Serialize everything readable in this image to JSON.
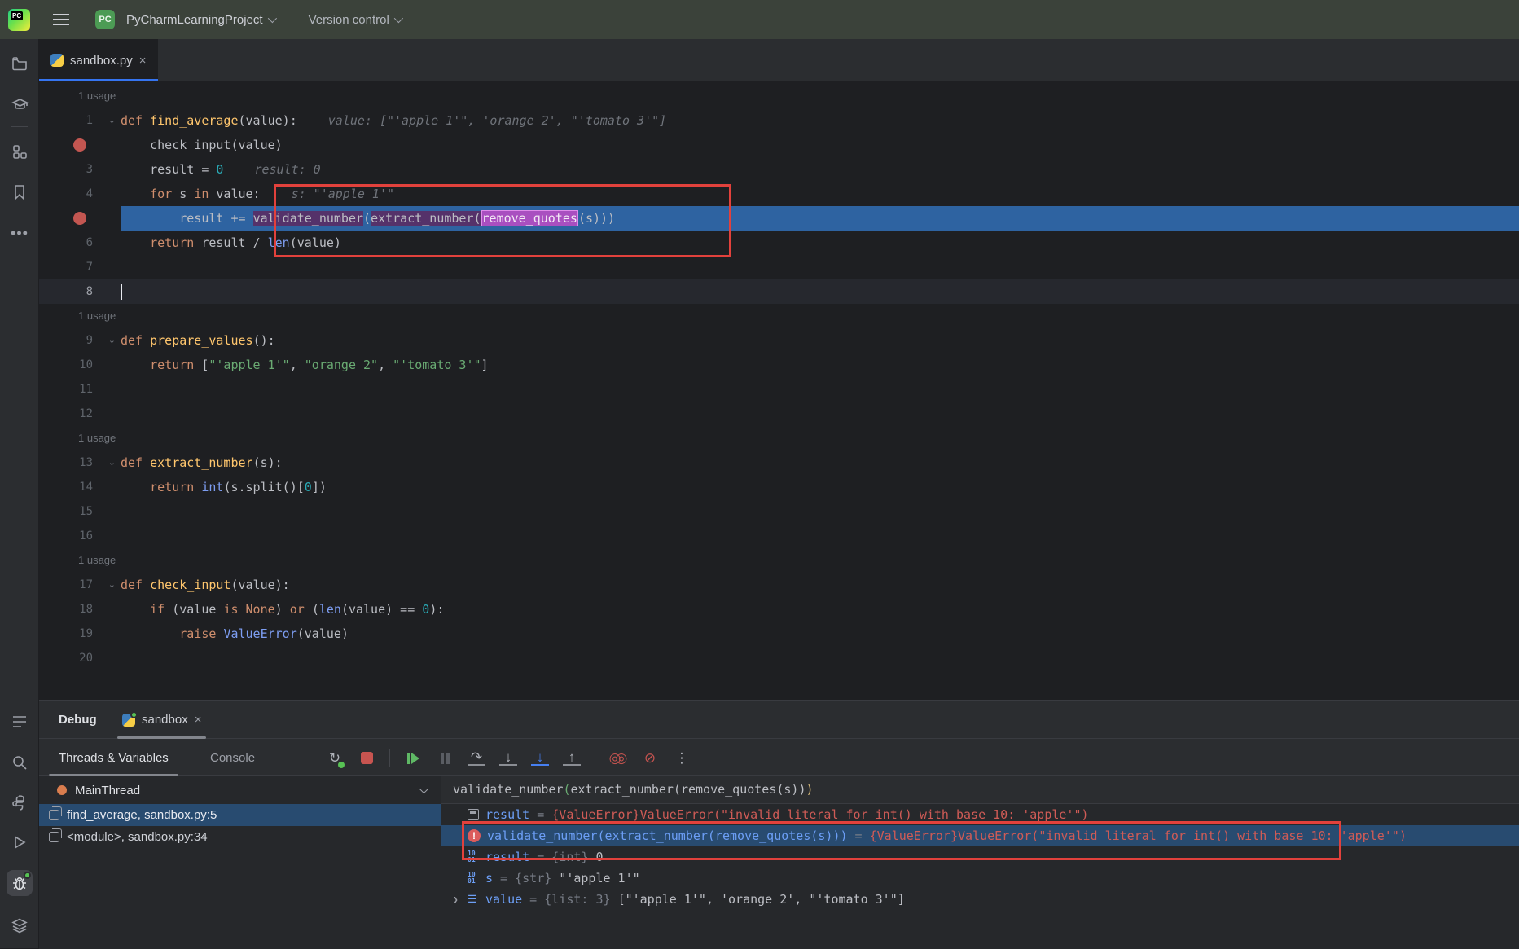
{
  "header": {
    "project_name": "PyCharmLearningProject",
    "vcs_label": "Version control",
    "logo_text": "PC",
    "project_badge": "PC"
  },
  "editor_tab": {
    "label": "sandbox.py",
    "close": "×"
  },
  "editor": {
    "rows": [
      {
        "usage": "1 usage"
      },
      {
        "n": "1",
        "fold": true,
        "segs": [
          [
            "kw",
            "def "
          ],
          [
            "fn",
            "find_average"
          ],
          [
            "plain",
            "(value):"
          ]
        ],
        "hint": "value: [\"'apple 1'\", 'orange 2', \"'tomato 3'\"]"
      },
      {
        "bp": true,
        "segs": [
          [
            "plain",
            "    check_input(value)"
          ]
        ]
      },
      {
        "n": "3",
        "segs": [
          [
            "plain",
            "    result = "
          ],
          [
            "num",
            "0"
          ]
        ],
        "hint": "result: 0"
      },
      {
        "n": "4",
        "segs": [
          [
            "kw",
            "    for "
          ],
          [
            "plain",
            "s "
          ],
          [
            "kw",
            "in "
          ],
          [
            "plain",
            "value:"
          ]
        ],
        "hint": "s: \"'apple 1'\""
      },
      {
        "bp": true,
        "cur": true,
        "segs": [
          [
            "plain",
            "        result += "
          ],
          [
            "p1",
            "validate_number"
          ],
          [
            "plain",
            "("
          ],
          [
            "p1",
            "extract_number("
          ],
          [
            "p2",
            "remove_quotes"
          ],
          [
            "plain",
            "(s)))"
          ]
        ]
      },
      {
        "n": "6",
        "segs": [
          [
            "kw",
            "    return "
          ],
          [
            "plain",
            "result / "
          ],
          [
            "builtin",
            "len"
          ],
          [
            "plain",
            "(value)"
          ]
        ]
      },
      {
        "n": "7",
        "segs": []
      },
      {
        "n": "8",
        "caret": true,
        "segs": []
      },
      {
        "usage": "1 usage"
      },
      {
        "n": "9",
        "fold": true,
        "segs": [
          [
            "kw",
            "def "
          ],
          [
            "fn",
            "prepare_values"
          ],
          [
            "plain",
            "():"
          ]
        ]
      },
      {
        "n": "10",
        "segs": [
          [
            "kw",
            "    return "
          ],
          [
            "plain",
            "["
          ],
          [
            "str",
            "\"'apple 1'\""
          ],
          [
            "plain",
            ", "
          ],
          [
            "str",
            "\"orange 2\""
          ],
          [
            "plain",
            ", "
          ],
          [
            "str",
            "\"'tomato 3'\""
          ],
          [
            "plain",
            "]"
          ]
        ]
      },
      {
        "n": "11",
        "segs": []
      },
      {
        "n": "12",
        "segs": []
      },
      {
        "usage": "1 usage"
      },
      {
        "n": "13",
        "fold": true,
        "segs": [
          [
            "kw",
            "def "
          ],
          [
            "fn",
            "extract_number"
          ],
          [
            "plain",
            "(s):"
          ]
        ]
      },
      {
        "n": "14",
        "segs": [
          [
            "kw",
            "    return "
          ],
          [
            "builtin",
            "int"
          ],
          [
            "plain",
            "(s.split()["
          ],
          [
            "num",
            "0"
          ],
          [
            "plain",
            "])"
          ]
        ]
      },
      {
        "n": "15",
        "segs": []
      },
      {
        "n": "16",
        "segs": []
      },
      {
        "usage": "1 usage"
      },
      {
        "n": "17",
        "fold": true,
        "segs": [
          [
            "kw",
            "def "
          ],
          [
            "fn",
            "check_input"
          ],
          [
            "plain",
            "(value):"
          ]
        ]
      },
      {
        "n": "18",
        "segs": [
          [
            "kw",
            "    if "
          ],
          [
            "plain",
            "(value "
          ],
          [
            "kw",
            "is "
          ],
          [
            "kw",
            "None"
          ],
          [
            "plain",
            ") "
          ],
          [
            "kw",
            "or "
          ],
          [
            "plain",
            "("
          ],
          [
            "builtin",
            "len"
          ],
          [
            "plain",
            "(value) == "
          ],
          [
            "num",
            "0"
          ],
          [
            "plain",
            "):"
          ]
        ]
      },
      {
        "n": "19",
        "segs": [
          [
            "kw",
            "        raise "
          ],
          [
            "builtin",
            "ValueError"
          ],
          [
            "plain",
            "(value)"
          ]
        ]
      },
      {
        "n": "20",
        "segs": []
      }
    ]
  },
  "debug_panel": {
    "title": "Debug",
    "session_tab": {
      "label": "sandbox",
      "close": "×"
    },
    "subtabs": {
      "threads": "Threads & Variables",
      "console": "Console"
    },
    "toolbar_icons": [
      "rerun-debugger",
      "stop",
      "resume",
      "pause",
      "step-over",
      "step-into",
      "force-step-into",
      "step-out",
      "view-breakpoints",
      "mute-breakpoints",
      "more-options"
    ],
    "thread": {
      "name": "MainThread"
    },
    "frames": [
      {
        "label": "find_average, sandbox.py:5",
        "selected": true
      },
      {
        "label": "<module>, sandbox.py:34",
        "selected": false
      }
    ],
    "variables": {
      "header_expression": {
        "pre": "validate_number",
        "open": "(",
        "mid": "extract_number(remove_quotes(s))",
        "close": ")"
      },
      "rows": [
        {
          "icon": "eval",
          "struck": true,
          "segs": [
            [
              "name",
              "result"
            ],
            [
              "eq",
              " = "
            ],
            [
              "err",
              "{ValueError}ValueError(\"invalid literal for int() with base 10: 'apple'\")"
            ]
          ]
        },
        {
          "icon": "error",
          "selected": true,
          "segs": [
            [
              "name",
              "validate_number(extract_number(remove_quotes(s)))"
            ],
            [
              "eq",
              " = "
            ],
            [
              "err",
              "{ValueError}ValueError(\"invalid literal for int() with base 10: 'apple'\")"
            ]
          ]
        },
        {
          "icon": "prim",
          "segs": [
            [
              "name",
              "result"
            ],
            [
              "eq",
              " = "
            ],
            [
              "type",
              "{int} "
            ],
            [
              "val",
              "0"
            ]
          ]
        },
        {
          "icon": "prim",
          "segs": [
            [
              "name",
              "s"
            ],
            [
              "eq",
              " = "
            ],
            [
              "type",
              "{str} "
            ],
            [
              "val",
              "\"'apple 1'\""
            ]
          ]
        },
        {
          "icon": "list",
          "chevron": true,
          "segs": [
            [
              "name",
              "value"
            ],
            [
              "eq",
              " = "
            ],
            [
              "type",
              "{list: 3} "
            ],
            [
              "val",
              "[\"'apple 1'\", 'orange 2', \"'tomato 3'\"]"
            ]
          ]
        }
      ]
    }
  },
  "colors": {
    "annotation_red": "#e2413c",
    "current_line_blue": "#2e63a1",
    "selection_purple": "#55326a",
    "selection_pink": "#a94fc0",
    "breakpoint_red": "#c35651",
    "accent_blue": "#3574f0"
  }
}
